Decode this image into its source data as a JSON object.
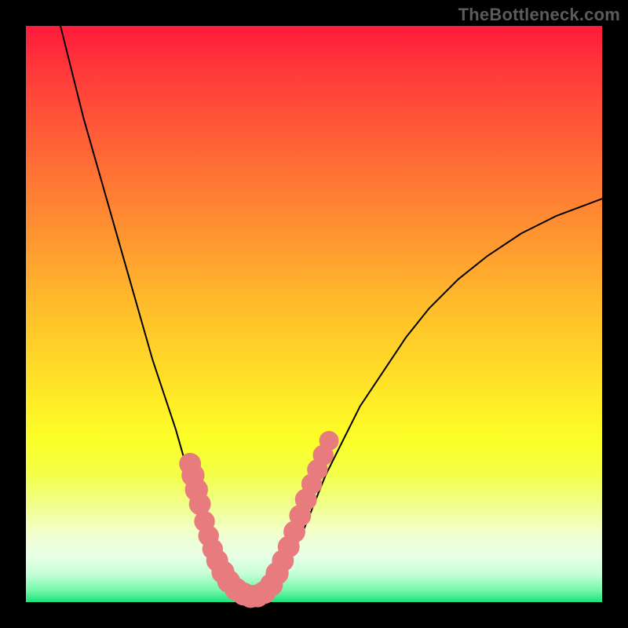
{
  "watermark": "TheBottleneck.com",
  "colors": {
    "curve": "#000000",
    "marker": "#e77b7d",
    "frame_bg": "#000000"
  },
  "chart_data": {
    "type": "line",
    "title": "",
    "xlabel": "",
    "ylabel": "",
    "xlim": [
      0,
      100
    ],
    "ylim": [
      0,
      100
    ],
    "series": [
      {
        "name": "left_branch",
        "x": [
          6,
          8,
          10,
          12,
          14,
          16,
          18,
          20,
          22,
          24,
          26,
          28,
          29,
          30,
          31,
          32,
          33,
          34,
          35,
          36
        ],
        "y": [
          100,
          92,
          84,
          77,
          70,
          63,
          56,
          49,
          42,
          36,
          30,
          23,
          20,
          17,
          14,
          11,
          8,
          6,
          4,
          2
        ]
      },
      {
        "name": "valley",
        "x": [
          36,
          37,
          38,
          39,
          40,
          41,
          42
        ],
        "y": [
          2,
          1.2,
          0.8,
          0.6,
          0.7,
          1.0,
          1.6
        ]
      },
      {
        "name": "right_branch",
        "x": [
          42,
          44,
          46,
          48,
          50,
          52,
          55,
          58,
          62,
          66,
          70,
          75,
          80,
          86,
          92,
          100
        ],
        "y": [
          1.6,
          4,
          8,
          12,
          17,
          22,
          28,
          34,
          40,
          46,
          51,
          56,
          60,
          64,
          67,
          70
        ]
      }
    ],
    "markers": [
      {
        "x": 28.5,
        "y": 24,
        "r": 1.9
      },
      {
        "x": 29.0,
        "y": 22,
        "r": 2.0
      },
      {
        "x": 29.6,
        "y": 19.5,
        "r": 2.0
      },
      {
        "x": 30.2,
        "y": 17,
        "r": 1.9
      },
      {
        "x": 31.0,
        "y": 14,
        "r": 1.8
      },
      {
        "x": 31.7,
        "y": 11.5,
        "r": 1.8
      },
      {
        "x": 32.4,
        "y": 9.2,
        "r": 1.8
      },
      {
        "x": 33.2,
        "y": 7.2,
        "r": 1.9
      },
      {
        "x": 34.2,
        "y": 5.2,
        "r": 2.0
      },
      {
        "x": 35.2,
        "y": 3.6,
        "r": 2.0
      },
      {
        "x": 36.5,
        "y": 2.2,
        "r": 2.0
      },
      {
        "x": 37.8,
        "y": 1.4,
        "r": 2.0
      },
      {
        "x": 39.0,
        "y": 1.0,
        "r": 2.0
      },
      {
        "x": 40.2,
        "y": 1.1,
        "r": 2.0
      },
      {
        "x": 41.4,
        "y": 1.7,
        "r": 2.0
      },
      {
        "x": 42.6,
        "y": 3.0,
        "r": 2.0
      },
      {
        "x": 43.6,
        "y": 5.0,
        "r": 2.0
      },
      {
        "x": 44.6,
        "y": 7.2,
        "r": 1.9
      },
      {
        "x": 45.6,
        "y": 9.6,
        "r": 1.9
      },
      {
        "x": 46.6,
        "y": 12.2,
        "r": 1.9
      },
      {
        "x": 47.6,
        "y": 15.0,
        "r": 1.9
      },
      {
        "x": 48.6,
        "y": 17.8,
        "r": 1.9
      },
      {
        "x": 49.6,
        "y": 20.5,
        "r": 1.8
      },
      {
        "x": 50.6,
        "y": 23.0,
        "r": 1.8
      },
      {
        "x": 51.6,
        "y": 25.5,
        "r": 1.8
      },
      {
        "x": 52.6,
        "y": 28.0,
        "r": 1.7
      }
    ]
  }
}
